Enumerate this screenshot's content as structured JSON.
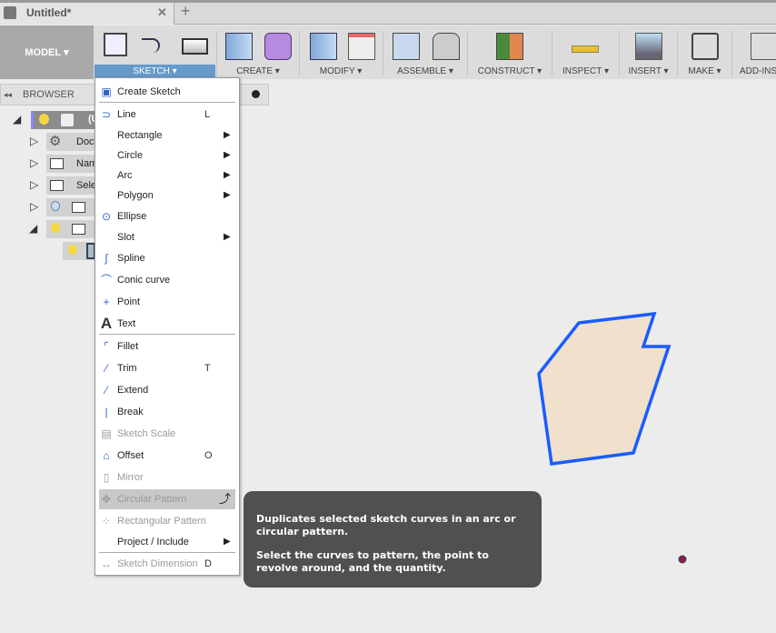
{
  "tab": {
    "title": "Untitled*",
    "close": "✕",
    "new": "+"
  },
  "toolbar": {
    "workspace": "MODEL",
    "groups": [
      {
        "label": "SKETCH ▾"
      },
      {
        "label": "CREATE ▾"
      },
      {
        "label": "MODIFY ▾"
      },
      {
        "label": "ASSEMBLE ▾"
      },
      {
        "label": "CONSTRUCT ▾"
      },
      {
        "label": "INSPECT ▾"
      },
      {
        "label": "INSERT ▾"
      },
      {
        "label": "MAKE ▾"
      },
      {
        "label": "ADD-INS"
      }
    ]
  },
  "browser": {
    "title": "BROWSER",
    "rows": [
      "(U",
      "Doc",
      "Nam",
      "Sele",
      "",
      ""
    ]
  },
  "menu": {
    "items": [
      {
        "label": "Create Sketch",
        "icon": "create-sketch-icon"
      },
      {
        "label": "Line",
        "shortcut": "L",
        "icon": "line-icon"
      },
      {
        "label": "Rectangle",
        "submenu": true
      },
      {
        "label": "Circle",
        "submenu": true
      },
      {
        "label": "Arc",
        "submenu": true
      },
      {
        "label": "Polygon",
        "submenu": true
      },
      {
        "label": "Ellipse",
        "icon": "ellipse-icon"
      },
      {
        "label": "Slot",
        "submenu": true
      },
      {
        "label": "Spline",
        "icon": "spline-icon"
      },
      {
        "label": "Conic curve",
        "icon": "conic-curve-icon"
      },
      {
        "label": "Point",
        "icon": "point-icon"
      },
      {
        "label": "Text",
        "icon": "text-icon"
      },
      {
        "label": "Fillet",
        "icon": "fillet-icon"
      },
      {
        "label": "Trim",
        "shortcut": "T",
        "icon": "trim-icon"
      },
      {
        "label": "Extend",
        "icon": "extend-icon"
      },
      {
        "label": "Break",
        "icon": "break-icon"
      },
      {
        "label": "Sketch Scale",
        "icon": "sketch-scale-icon",
        "disabled": true
      },
      {
        "label": "Offset",
        "shortcut": "O",
        "icon": "offset-icon"
      },
      {
        "label": "Mirror",
        "icon": "mirror-icon",
        "disabled": true
      },
      {
        "label": "Circular Pattern",
        "icon": "circular-pattern-icon",
        "disabled": true,
        "highlighted": true
      },
      {
        "label": "Rectangular Pattern",
        "icon": "rectangular-pattern-icon",
        "disabled": true
      },
      {
        "label": "Project / Include",
        "submenu": true
      },
      {
        "label": "Sketch Dimension",
        "shortcut": "D",
        "icon": "sketch-dimension-icon",
        "disabled": true
      }
    ]
  },
  "tooltip": {
    "line1": "Duplicates selected sketch curves in an arc or circular pattern.",
    "line2": "Select the curves to pattern, the point to revolve around, and the quantity."
  },
  "colors": {
    "accent": "#6699cc",
    "sketch_line": "#1a5cff",
    "profile_fill": "#f0e0cc",
    "point": "#8b1a5a"
  }
}
